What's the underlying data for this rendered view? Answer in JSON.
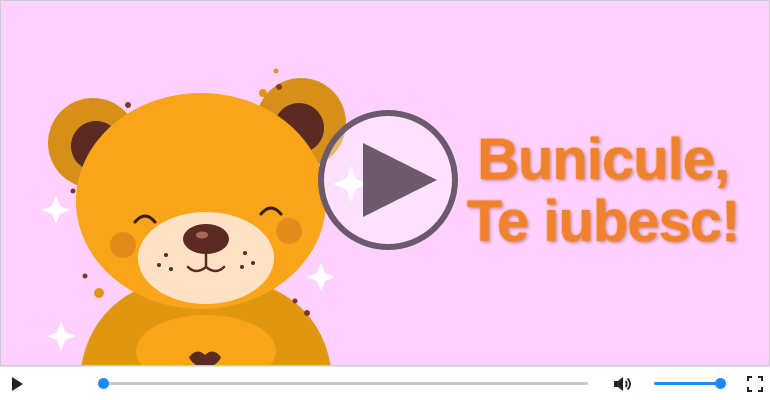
{
  "video": {
    "title_line1": "Bunicule,",
    "title_line2": "Te iubesc!",
    "background_color": "#ffd1ff",
    "title_color": "#f0822d"
  },
  "controls": {
    "play_icon": "play-icon",
    "volume_icon": "volume-icon",
    "fullscreen_icon": "fullscreen-icon",
    "progress_fraction": 0.0,
    "volume_fraction": 1.0,
    "accent_color": "#1e88ff"
  }
}
